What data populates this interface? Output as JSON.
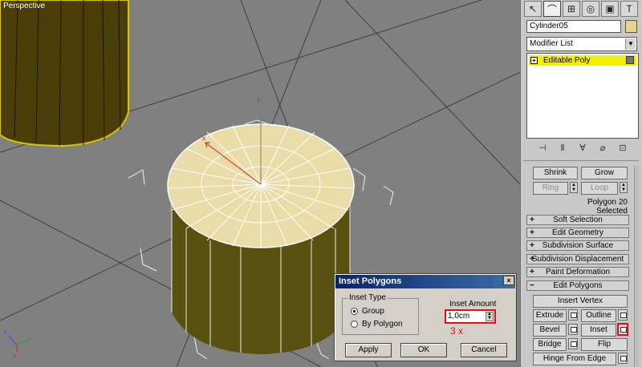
{
  "viewport": {
    "label": "Perspective"
  },
  "panel": {
    "tabs": [
      "create-tab",
      "modify-tab",
      "hierarchy-tab",
      "motion-tab",
      "display-tab",
      "utilities-tab"
    ],
    "object_name": "Cylinder05",
    "modifier_list": "Modifier List",
    "stack_item": "Editable Poly",
    "shrink": "Shrink",
    "grow": "Grow",
    "ring": "Ring",
    "loop": "Loop",
    "selected_text": "Polygon 20 Selected",
    "rollouts": {
      "soft_selection": "Soft Selection",
      "edit_geometry": "Edit Geometry",
      "subdivision_surface": "Subdivision Surface",
      "subdivision_displacement": "Subdivision Displacement",
      "paint_deformation": "Paint Deformation",
      "edit_polygons": "Edit Polygons"
    },
    "edit_polygons": {
      "insert_vertex": "Insert Vertex",
      "extrude": "Extrude",
      "outline": "Outline",
      "bevel": "Bevel",
      "inset": "Inset",
      "bridge": "Bridge",
      "flip": "Flip",
      "hinge_from_edge": "Hinge From Edge"
    }
  },
  "dialog": {
    "title": "Inset Polygons",
    "close": "×",
    "inset_type_label": "Inset Type",
    "option_group": "Group",
    "option_by_polygon": "By Polygon",
    "selected_option": "Group",
    "amount_label": "Inset Amount",
    "amount_value": "1,0cm",
    "annotation": "3 x",
    "apply": "Apply",
    "ok": "OK",
    "cancel": "Cancel"
  },
  "colors": {
    "highlight": "#e01010",
    "selection": "#f5f000",
    "title_bar": "#0a246a"
  }
}
